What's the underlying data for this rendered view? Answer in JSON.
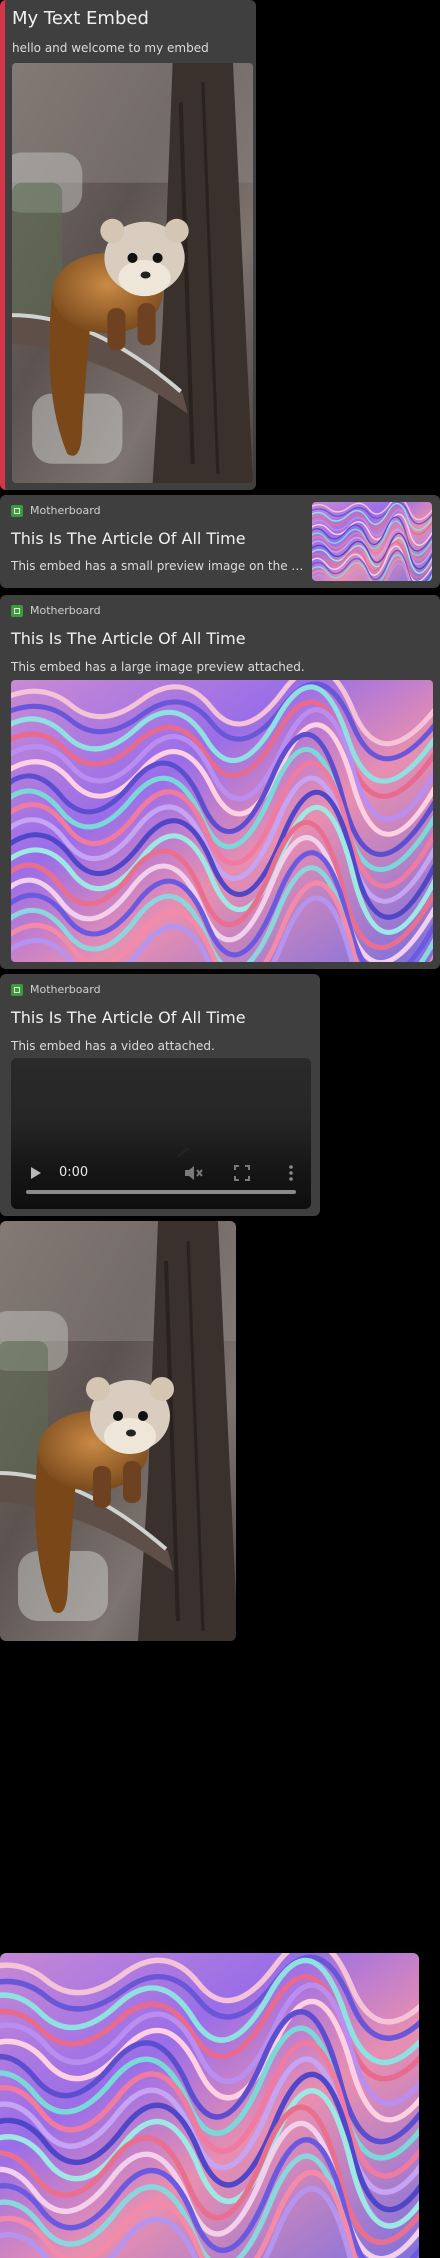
{
  "embeds": [
    {
      "title": "My Text Embed",
      "description": "hello and welcome to my embed",
      "accent_color": "#d6364a",
      "image": "marten-photo"
    },
    {
      "provider": "Motherboard",
      "title": "This Is The Article Of All Time",
      "description": "This embed has a small preview image on the right.",
      "thumbnail": "wavy-art-preview"
    },
    {
      "provider": "Motherboard",
      "title": "This Is The Article Of All Time",
      "description": "This embed has a large image preview attached.",
      "image": "wavy-art-preview"
    },
    {
      "provider": "Motherboard",
      "title": "This Is The Article Of All Time",
      "description": "This embed has a video attached.",
      "video": {
        "current_time": "0:00",
        "progress": 0
      }
    }
  ],
  "standalone_images": [
    "marten-photo",
    "wavy-art-preview"
  ],
  "icons": {
    "provider": "provider-favicon-icon",
    "play": "play-icon",
    "mute": "volume-muted-icon",
    "fullscreen": "fullscreen-icon",
    "more": "more-options-icon"
  },
  "colors": {
    "background": "#000000",
    "embed_background": "#3f3f3f",
    "provider_icon": "#3c9c3a"
  }
}
